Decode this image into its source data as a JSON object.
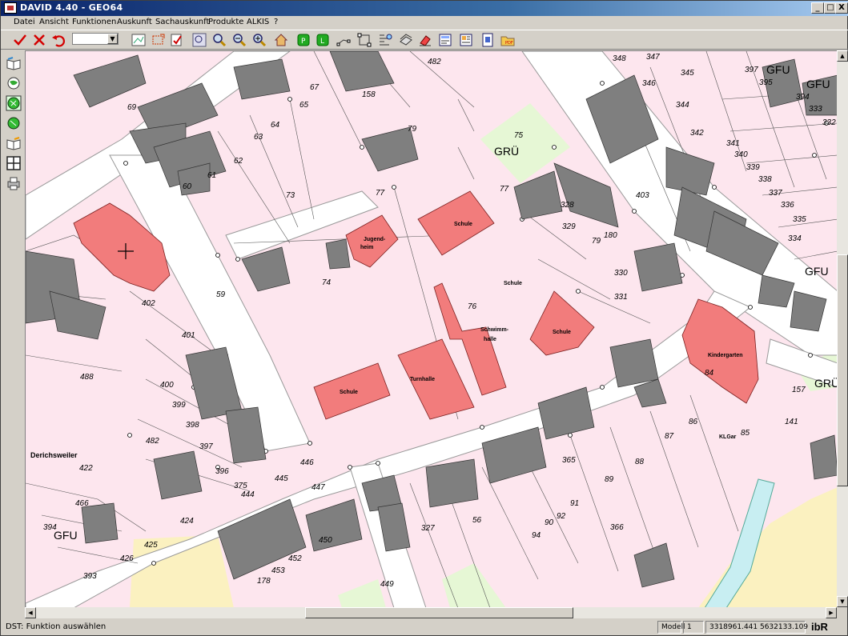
{
  "window": {
    "title": "DAVID 4.40 - GEO64",
    "min": "_",
    "max": "□",
    "close": "X"
  },
  "menu": [
    "Datei",
    "Ansicht",
    "Funktionen",
    "Auskunft",
    "Sachauskunft",
    "Produkte",
    "ALKIS",
    "?"
  ],
  "toolbar": {
    "icons": [
      "check-icon",
      "cancel-icon",
      "undo-icon",
      "layer-select",
      "layers-icon",
      "select-area-icon",
      "edit-icon",
      "zoom-window-icon",
      "zoom-icon",
      "zoom-out-icon",
      "zoom-in-icon",
      "home-icon",
      "pan-icon",
      "redraw-icon",
      "measure-icon",
      "frame-icon",
      "map-tool-icon",
      "symbol-icon",
      "eraser-icon",
      "print-preview-icon",
      "document-icon",
      "export-icon",
      "pdf-icon"
    ]
  },
  "left_tools": [
    "book-icon",
    "globe-icon",
    "globe-green-icon",
    "globe-green2-icon",
    "book2-icon",
    "grid-icon",
    "printer-icon"
  ],
  "map": {
    "labels": {
      "gru1": "GRÜ",
      "gfu1": "GFU",
      "gfu2": "GFU",
      "gfu3": "GFU",
      "gfu4": "GFU",
      "gfu5": "GFU",
      "gru2": "GRÜ",
      "schule1": "Schule",
      "schule2": "Schule",
      "schule3": "Schule",
      "schule4": "Schule",
      "jugendheim1": "Jugend-",
      "jugendheim2": "heim",
      "turnhalle": "Turnhalle",
      "schwimm1": "Schwimm-",
      "schwimm2": "halle",
      "kindergarten": "Kindergarten",
      "derichsweiler": "Derichsweiler",
      "klgar": "KLGar",
      "n482a": "482",
      "n69": "69",
      "n67": "67",
      "n65": "65",
      "n64": "64",
      "n63": "63",
      "n62": "62",
      "n61": "61",
      "n60": "60",
      "n158": "158",
      "n79": "79",
      "n75": "75",
      "n77": "77",
      "n73": "73",
      "n74": "74",
      "n76": "76",
      "n78": "78",
      "n348": "348",
      "n347": "347",
      "n346": "346",
      "n345": "345",
      "n344": "344",
      "n342": "342",
      "n341": "341",
      "n340": "340",
      "n339": "339",
      "n338": "338",
      "n337": "337",
      "n336": "336",
      "n335": "335",
      "n334": "334",
      "n333": "333",
      "n332": "332",
      "n395": "395",
      "n394": "394",
      "n397": "397",
      "n403": "403",
      "n328": "328",
      "n329": "329",
      "n330": "330",
      "n331": "331",
      "n180": "180",
      "n79b": "79",
      "n402": "402",
      "n401": "401",
      "n400": "400",
      "n399": "399",
      "n398": "398",
      "n397b": "397",
      "n396": "396",
      "n59": "59",
      "n488": "488",
      "n482b": "482",
      "n422": "422",
      "n466": "466",
      "n394b": "394",
      "n424": "424",
      "n425": "425",
      "n426": "426",
      "n393": "393",
      "n446": "446",
      "n445": "445",
      "n447": "447",
      "n444": "444",
      "n375": "375",
      "n450": "450",
      "n452": "452",
      "n453": "453",
      "n178": "178",
      "n449": "449",
      "n327": "327",
      "n56": "56",
      "n94": "94",
      "n90": "90",
      "n92": "92",
      "n91": "91",
      "n89": "89",
      "n365": "365",
      "n366": "366",
      "n88": "88",
      "n87": "87",
      "n86": "86",
      "n84": "84",
      "n85": "85",
      "n141": "141",
      "n157": "157",
      "n41": "41",
      "n51": "51",
      "n83": "83"
    }
  },
  "status": {
    "text": "DST: Funktion auswählen",
    "modell_label": "Modell",
    "modell_value": "1",
    "coords": "3318961.441  5632133.109",
    "logo": "ibR"
  },
  "colors": {
    "parcel": "#fde6ee",
    "street": "#ffffff",
    "building": "#7f7f7f",
    "public": "#f27c7c",
    "green": "#e6f7d5",
    "sand": "#fbf1c0",
    "water": "#c8eef2"
  }
}
